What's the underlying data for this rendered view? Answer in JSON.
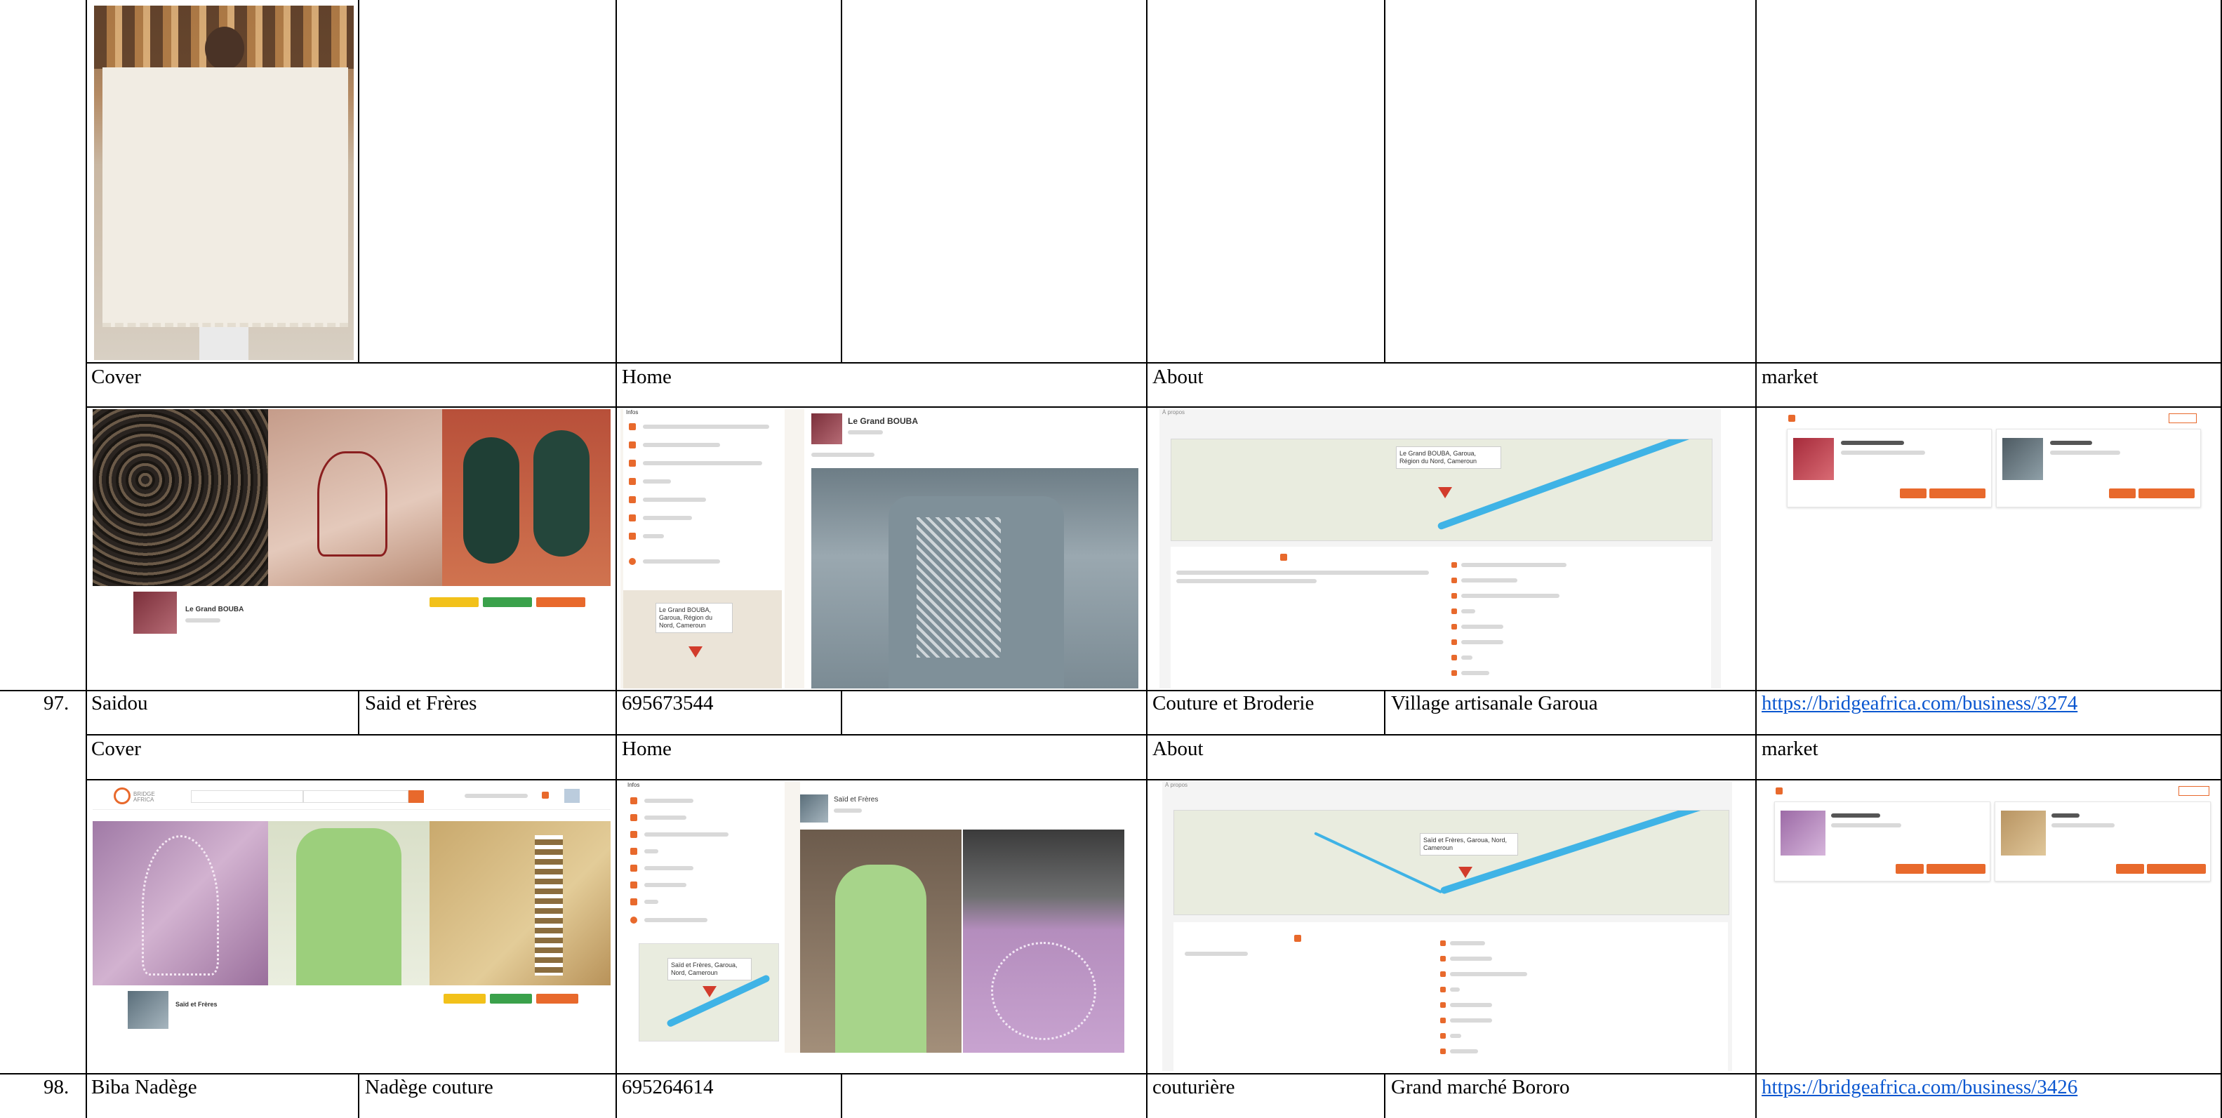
{
  "tab_labels": {
    "cover": "Cover",
    "home": "Home",
    "about": "About",
    "market": "market"
  },
  "entries": [
    {
      "index": "97.",
      "name": "Saidou",
      "business": "Said et Frères",
      "phone": "695673544",
      "activity": "Couture et Broderie",
      "location": "Village artisanale Garoua",
      "link": "https://bridgeafrica.com/business/3274"
    },
    {
      "index": "98.",
      "name": "Biba Nadège",
      "business": "Nadège couture",
      "phone": "695264614",
      "activity": "couturière",
      "location": "Grand marché Bororo",
      "link": "https://bridgeafrica.com/business/3426"
    }
  ],
  "previews": {
    "previous": {
      "cover_profile_name": "Le Grand BOUBA",
      "home_profile_name": "Le Grand BOUBA",
      "about_map_bubble": "Le Grand BOUBA, Garoua, Région du Nord, Cameroun",
      "home_map_bubble": "Le Grand BOUBA, Garoua, Région du Nord, Cameroun",
      "home_sidebar_label": "Infos"
    },
    "current": {
      "cover_profile_name": "Saïd et Frères",
      "home_profile_name": "Saïd et Frères",
      "about_map_bubble": "Saïd et Frères, Garoua, Nord, Cameroun",
      "home_map_bubble": "Saïd et Frères, Garoua, Nord, Cameroun",
      "home_sidebar_label": "Infos",
      "header_logo": "BRIDGE AFRICA"
    }
  },
  "colors": {
    "brand_orange": "#e8692c",
    "link_blue": "#0b57d0",
    "map_river": "#3fb3e6",
    "map_land": "#e9ecdf"
  }
}
